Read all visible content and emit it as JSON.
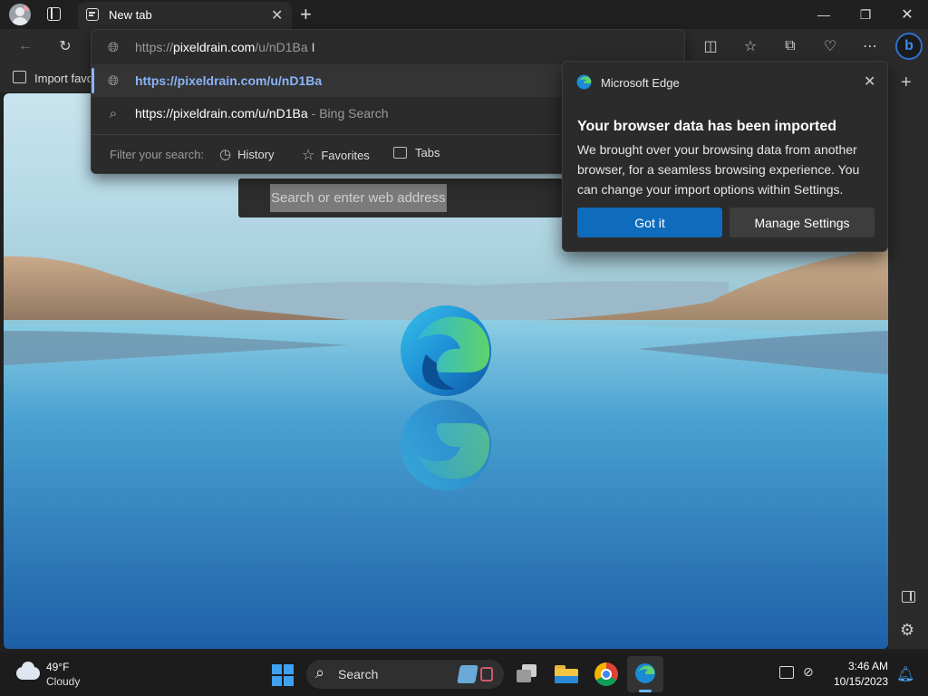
{
  "tab": {
    "title": "New tab"
  },
  "address": {
    "typed_prefix": "https://",
    "typed_domain": "pixeldrain.com",
    "typed_path": "/u/nD1Ba",
    "suggestion_url": "https://pixeldrain.com/u/nD1Ba",
    "search_query": "https://pixeldrain.com/u/nD1Ba",
    "search_suffix": "- Bing Search",
    "filter_label": "Filter your search:",
    "filters": [
      "History",
      "Favorites",
      "Tabs"
    ]
  },
  "favorites_bar": {
    "import_label": "Import favo"
  },
  "page": {
    "search_placeholder": "Search or enter web address"
  },
  "popup": {
    "app_name": "Microsoft Edge",
    "heading": "Your browser data has been imported",
    "body": "We brought over your browsing data from another browser, for a seamless browsing experience. You can change your import options within Settings.",
    "primary_button": "Got it",
    "secondary_button": "Manage Settings"
  },
  "taskbar": {
    "weather_temp": "49°F",
    "weather_desc": "Cloudy",
    "search_label": "Search",
    "time": "3:46 AM",
    "date": "10/15/2023"
  },
  "colors": {
    "accent": "#0f6cbd",
    "link": "#8ab4f8",
    "background": "#202020"
  }
}
